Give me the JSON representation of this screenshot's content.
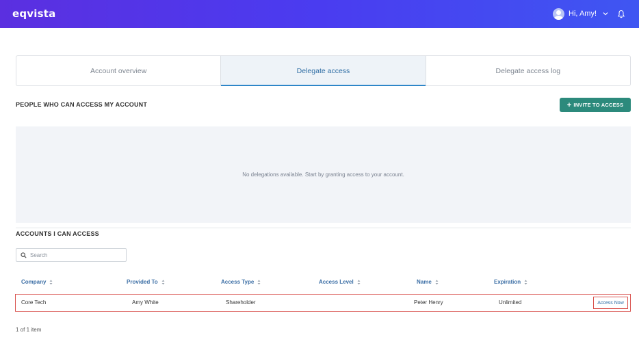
{
  "header": {
    "logo": "eqvista",
    "greeting": "Hi, Amy!"
  },
  "tabs": [
    {
      "label": "Account overview",
      "active": false
    },
    {
      "label": "Delegate access",
      "active": true
    },
    {
      "label": "Delegate access log",
      "active": false
    }
  ],
  "delegations": {
    "title": "PEOPLE WHO CAN ACCESS MY ACCOUNT",
    "invite_button": "INVITE TO ACCESS",
    "empty_message": "No delegations available. Start by granting access to your account."
  },
  "accounts": {
    "title": "ACCOUNTS I CAN ACCESS",
    "search_placeholder": "Search",
    "columns": [
      "Company",
      "Provided To",
      "Access Type",
      "Access Level",
      "Name",
      "Expiration"
    ],
    "rows": [
      {
        "company": "Core Tech",
        "provided_to": "Amy White",
        "access_type": "Shareholder",
        "access_level": "",
        "name": "Peter Henry",
        "expiration": "Unlimited",
        "action": "Access Now"
      }
    ],
    "pagination": "1 of 1 item"
  },
  "colors": {
    "header_gradient_start": "#5b2fe0",
    "header_gradient_end": "#3f56f2",
    "invite_button": "#2c8a7c",
    "highlight": "#d9534f",
    "link": "#3b6ea5"
  }
}
